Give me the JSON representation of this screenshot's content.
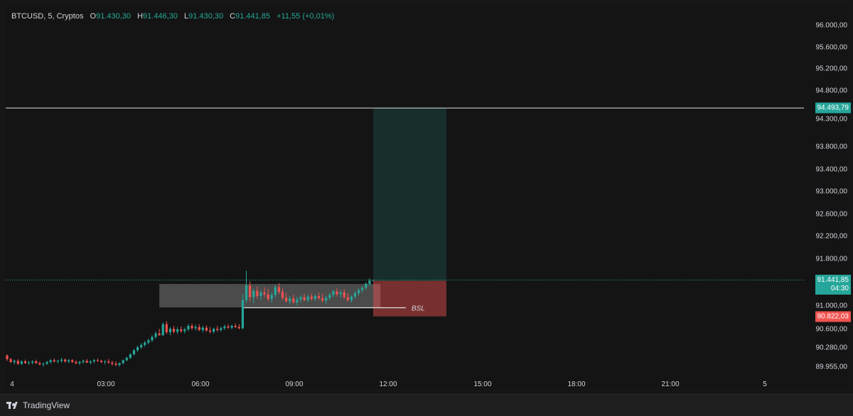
{
  "header": {
    "symbol": "BTCUSD, 5, Cryptos",
    "o_label": "O",
    "o_val": "91.430,30",
    "h_label": "H",
    "h_val": "91.446,30",
    "l_label": "L",
    "l_val": "91.430,30",
    "c_label": "C",
    "c_val": "91.441,85",
    "change": "+11,55 (+0,01%)"
  },
  "price_ticks": [
    "96.000,00",
    "95.600,00",
    "95.200,00",
    "94.800,00",
    "94.300,00",
    "93.800,00",
    "93.400,00",
    "93.000,00",
    "92.600,00",
    "92.200,00",
    "91.800,00",
    "91.000,00",
    "90.600,00",
    "90.280,00",
    "89.955,00"
  ],
  "time_ticks": [
    "4",
    "03:00",
    "06:00",
    "09:00",
    "12:00",
    "15:00",
    "18:00",
    "21:00",
    "5"
  ],
  "badges": {
    "target": "94.493,79",
    "current": "91.441,85",
    "countdown": "04:30",
    "stop": "90.822,03"
  },
  "annotation": {
    "bsl": "BSL"
  },
  "footer": {
    "brand": "TradingView"
  },
  "colors": {
    "up": "#26a69a",
    "down": "#ef5350",
    "bg": "#141414"
  },
  "chart_data": {
    "type": "candlestick",
    "x_label": "",
    "y_label": "",
    "ylim": [
      89900,
      96100
    ],
    "series": [
      {
        "name": "",
        "interval": "5m",
        "ohlc": [
          [
            90150,
            90170,
            90060,
            90090
          ],
          [
            90090,
            90110,
            90020,
            90040
          ],
          [
            90040,
            90080,
            90000,
            90060
          ],
          [
            90060,
            90090,
            89990,
            90010
          ],
          [
            90010,
            90070,
            89990,
            90050
          ],
          [
            90050,
            90080,
            90010,
            90020
          ],
          [
            90020,
            90060,
            89995,
            90030
          ],
          [
            90030,
            90070,
            90000,
            90050
          ],
          [
            90050,
            90080,
            90010,
            90020
          ],
          [
            90020,
            90050,
            89980,
            90000
          ],
          [
            90000,
            90030,
            89960,
            90010
          ],
          [
            90010,
            90060,
            89990,
            90040
          ],
          [
            90040,
            90090,
            90010,
            90070
          ],
          [
            90070,
            90100,
            90030,
            90050
          ],
          [
            90050,
            90080,
            90020,
            90060
          ],
          [
            90060,
            90110,
            90030,
            90080
          ],
          [
            90080,
            90100,
            90030,
            90050
          ],
          [
            90050,
            90090,
            90020,
            90070
          ],
          [
            90070,
            90090,
            90020,
            90040
          ],
          [
            90040,
            90070,
            90000,
            90020
          ],
          [
            90020,
            90060,
            89990,
            90040
          ],
          [
            90040,
            90080,
            90010,
            90060
          ],
          [
            90060,
            90090,
            90020,
            90030
          ],
          [
            90030,
            90070,
            90000,
            90050
          ],
          [
            90050,
            90090,
            90020,
            90070
          ],
          [
            90070,
            90100,
            90040,
            90060
          ],
          [
            90060,
            90080,
            90020,
            90040
          ],
          [
            90040,
            90070,
            90000,
            90050
          ],
          [
            90050,
            90090,
            90010,
            90030
          ],
          [
            90030,
            90060,
            89980,
            90010
          ],
          [
            90010,
            90050,
            89970,
            89990
          ],
          [
            89990,
            90030,
            89960,
            90020
          ],
          [
            90020,
            90080,
            90000,
            90070
          ],
          [
            90070,
            90130,
            90050,
            90110
          ],
          [
            90110,
            90190,
            90090,
            90170
          ],
          [
            90170,
            90260,
            90150,
            90240
          ],
          [
            90240,
            90320,
            90210,
            90290
          ],
          [
            90290,
            90360,
            90260,
            90330
          ],
          [
            90330,
            90400,
            90300,
            90370
          ],
          [
            90370,
            90440,
            90340,
            90410
          ],
          [
            90410,
            90500,
            90380,
            90470
          ],
          [
            90470,
            90560,
            90440,
            90530
          ],
          [
            90530,
            90610,
            90490,
            90500
          ],
          [
            90500,
            90720,
            90480,
            90690
          ],
          [
            90690,
            90740,
            90520,
            90550
          ],
          [
            90550,
            90640,
            90500,
            90610
          ],
          [
            90610,
            90660,
            90530,
            90560
          ],
          [
            90560,
            90640,
            90520,
            90600
          ],
          [
            90600,
            90650,
            90540,
            90570
          ],
          [
            90570,
            90630,
            90530,
            90600
          ],
          [
            90600,
            90690,
            90570,
            90660
          ],
          [
            90660,
            90700,
            90590,
            90620
          ],
          [
            90620,
            90680,
            90580,
            90640
          ],
          [
            90640,
            90690,
            90570,
            90590
          ],
          [
            90590,
            90660,
            90550,
            90630
          ],
          [
            90630,
            90670,
            90560,
            90580
          ],
          [
            90580,
            90640,
            90530,
            90560
          ],
          [
            90560,
            90630,
            90530,
            90610
          ],
          [
            90610,
            90660,
            90560,
            90590
          ],
          [
            90590,
            90650,
            90560,
            90620
          ],
          [
            90620,
            90680,
            90590,
            90650
          ],
          [
            90650,
            90690,
            90610,
            90630
          ],
          [
            90630,
            90680,
            90600,
            90660
          ],
          [
            90660,
            90700,
            90620,
            90640
          ],
          [
            90640,
            90690,
            90600,
            90620
          ],
          [
            90620,
            91200,
            90600,
            91100
          ],
          [
            91100,
            91600,
            91050,
            91350
          ],
          [
            91350,
            91420,
            91080,
            91150
          ],
          [
            91150,
            91300,
            91050,
            91260
          ],
          [
            91260,
            91330,
            91120,
            91170
          ],
          [
            91170,
            91280,
            91100,
            91230
          ],
          [
            91230,
            91320,
            91150,
            91200
          ],
          [
            91200,
            91290,
            91080,
            91120
          ],
          [
            91120,
            91230,
            91060,
            91190
          ],
          [
            91190,
            91360,
            91150,
            91320
          ],
          [
            91320,
            91390,
            91200,
            91240
          ],
          [
            91240,
            91300,
            91100,
            91140
          ],
          [
            91140,
            91220,
            91060,
            91080
          ],
          [
            91080,
            91170,
            91030,
            91130
          ],
          [
            91130,
            91190,
            91040,
            91060
          ],
          [
            91060,
            91160,
            91010,
            91110
          ],
          [
            91110,
            91190,
            91060,
            91150
          ],
          [
            91150,
            91210,
            91080,
            91100
          ],
          [
            91100,
            91190,
            91060,
            91160
          ],
          [
            91160,
            91220,
            91090,
            91120
          ],
          [
            91120,
            91200,
            91080,
            91170
          ],
          [
            91170,
            91230,
            91100,
            91130
          ],
          [
            91130,
            91210,
            91060,
            91090
          ],
          [
            91090,
            91170,
            91040,
            91140
          ],
          [
            91140,
            91220,
            91100,
            91190
          ],
          [
            91190,
            91280,
            91150,
            91250
          ],
          [
            91250,
            91300,
            91160,
            91200
          ],
          [
            91200,
            91270,
            91140,
            91230
          ],
          [
            91230,
            91290,
            91120,
            91150
          ],
          [
            91150,
            91220,
            91070,
            91100
          ],
          [
            91100,
            91180,
            91060,
            91160
          ],
          [
            91160,
            91250,
            91130,
            91220
          ],
          [
            91220,
            91300,
            91180,
            91270
          ],
          [
            91270,
            91340,
            91230,
            91310
          ],
          [
            91310,
            91400,
            91280,
            91380
          ],
          [
            91380,
            91470,
            91340,
            91430
          ],
          [
            91430,
            91446,
            91430,
            91442
          ]
        ]
      }
    ],
    "levels": [
      {
        "name": "",
        "value": 94493.79
      },
      {
        "name": "BSL",
        "value": 90970
      }
    ],
    "zones": [
      {
        "name": "",
        "type": "range",
        "from": 90975,
        "to": 91375
      },
      {
        "name": "",
        "type": "target",
        "from": 91430,
        "to": 94493.79
      },
      {
        "name": "",
        "type": "stop",
        "from": 90822.03,
        "to": 91430
      }
    ]
  }
}
